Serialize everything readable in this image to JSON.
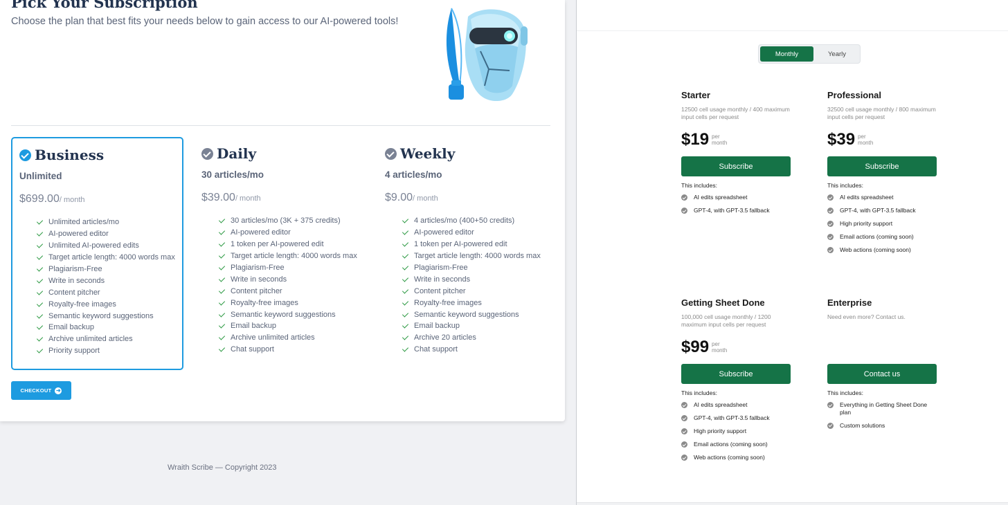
{
  "left": {
    "title": "Pick Your Subscription",
    "subtitle": "Choose the plan that best fits your needs below to gain access to our AI-powered tools!",
    "plans": [
      {
        "name": "Business",
        "subtitle": "Unlimited",
        "price": "$699.00",
        "period": "/ month",
        "selected": true,
        "features": [
          "Unlimited articles/mo",
          "AI-powered editor",
          "Unlimited AI-powered edits",
          "Target article length: 4000 words max",
          "Plagiarism-Free",
          "Write in seconds",
          "Content pitcher",
          "Royalty-free images",
          "Semantic keyword suggestions",
          "Email backup",
          "Archive unlimited articles",
          "Priority support"
        ]
      },
      {
        "name": "Daily",
        "subtitle": "30 articles/mo",
        "price": "$39.00",
        "period": "/ month",
        "selected": false,
        "features": [
          "30 articles/mo (3K + 375 credits)",
          "AI-powered editor",
          "1 token per AI-powered edit",
          "Target article length: 4000 words max",
          "Plagiarism-Free",
          "Write in seconds",
          "Content pitcher",
          "Royalty-free images",
          "Semantic keyword suggestions",
          "Email backup",
          "Archive unlimited articles",
          "Chat support"
        ]
      },
      {
        "name": "Weekly",
        "subtitle": "4 articles/mo",
        "price": "$9.00",
        "period": "/ month",
        "selected": false,
        "features": [
          "4 articles/mo (400+50 credits)",
          "AI-powered editor",
          "1 token per AI-powered edit",
          "Target article length: 4000 words max",
          "Plagiarism-Free",
          "Write in seconds",
          "Content pitcher",
          "Royalty-free images",
          "Semantic keyword suggestions",
          "Email backup",
          "Archive 20 articles",
          "Chat support"
        ]
      }
    ],
    "checkout_label": "CHECKOUT",
    "footer": "Wraith Scribe — Copyright 2023",
    "accent_color": "#1d9be0"
  },
  "right": {
    "toggle": {
      "monthly": "Monthly",
      "yearly": "Yearly",
      "active": "monthly"
    },
    "tiers": [
      {
        "name": "Starter",
        "desc": "12500 cell usage monthly / 400 maximum input cells per request",
        "price": "$19",
        "unit_top": "per",
        "unit_bottom": "month",
        "button": "Subscribe",
        "includes": "This includes:",
        "features": [
          "AI edits spreadsheet",
          "GPT-4, with GPT-3.5 fallback"
        ]
      },
      {
        "name": "Professional",
        "desc": "32500 cell usage monthly / 800 maximum input cells per request",
        "price": "$39",
        "unit_top": "per",
        "unit_bottom": "month",
        "button": "Subscribe",
        "includes": "This includes:",
        "features": [
          "AI edits spreadsheet",
          "GPT-4, with GPT-3.5 fallback",
          "High priority support",
          "Email actions (coming soon)",
          "Web actions (coming soon)"
        ]
      },
      {
        "name": "Getting Sheet Done",
        "desc": "100,000 cell usage monthly / 1200 maximum input cells per request",
        "price": "$99",
        "unit_top": "per",
        "unit_bottom": "month",
        "button": "Subscribe",
        "includes": "This includes:",
        "features": [
          "AI edits spreadsheet",
          "GPT-4, with GPT-3.5 fallback",
          "High priority support",
          "Email actions (coming soon)",
          "Web actions (coming soon)"
        ]
      },
      {
        "name": "Enterprise",
        "desc": "Need even more? Contact us.",
        "price": "",
        "unit_top": "",
        "unit_bottom": "",
        "button": "Contact us",
        "includes": "This includes:",
        "features": [
          "Everything in Getting Sheet Done plan",
          "Custom solutions"
        ]
      }
    ],
    "accent_color": "#157347"
  }
}
